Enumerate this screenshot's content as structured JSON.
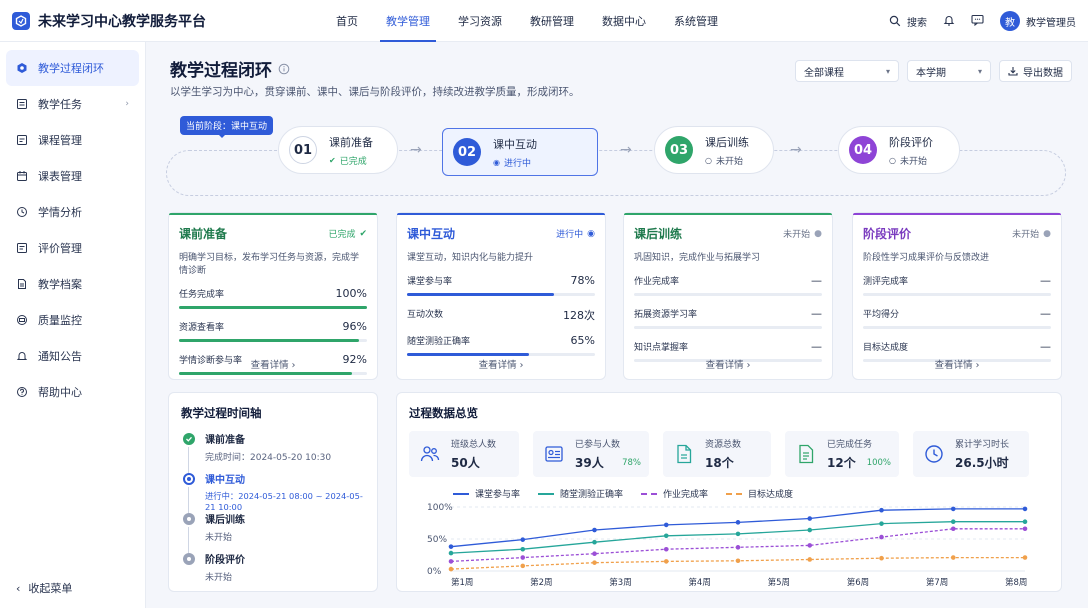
{
  "app": {
    "title": "未来学习中心教学服务平台"
  },
  "nav": [
    "首页",
    "教学管理",
    "学习资源",
    "教研管理",
    "数据中心",
    "系统管理"
  ],
  "nav_active": 1,
  "top": {
    "search": "搜索",
    "avatar_text": "教",
    "user": "教学管理员"
  },
  "sidebar": {
    "items": [
      {
        "label": "教学过程闭环",
        "icon": "loop-icon",
        "active": true
      },
      {
        "label": "教学任务",
        "icon": "task-icon",
        "has_children": true
      },
      {
        "label": "课程管理",
        "icon": "course-icon"
      },
      {
        "label": "课表管理",
        "icon": "calendar-icon"
      },
      {
        "label": "学情分析",
        "icon": "clock-icon"
      },
      {
        "label": "评价管理",
        "icon": "review-icon"
      },
      {
        "label": "教学档案",
        "icon": "archive-icon"
      },
      {
        "label": "质量监控",
        "icon": "monitor-icon"
      },
      {
        "label": "通知公告",
        "icon": "bell-icon"
      },
      {
        "label": "帮助中心",
        "icon": "help-icon"
      }
    ],
    "collapse": "收起菜单"
  },
  "page": {
    "title": "教学过程闭环",
    "subtitle": "以学生学习为中心，贯穿课前、课中、课后与阶段评价，持续改进教学质量，形成闭环。",
    "select_course": "全部课程",
    "select_term": "本学期",
    "export": "导出数据"
  },
  "flow": {
    "current_tag": "当前阶段：课中互动",
    "stages": [
      {
        "num": "01",
        "name": "课前准备",
        "status": "已完成",
        "state": "done"
      },
      {
        "num": "02",
        "name": "课中互动",
        "status": "进行中",
        "state": "active"
      },
      {
        "num": "03",
        "name": "课后训练",
        "status": "未开始",
        "state": "todo"
      },
      {
        "num": "04",
        "name": "阶段评价",
        "status": "未开始",
        "state": "todo"
      }
    ]
  },
  "cards": [
    {
      "title": "课前准备",
      "badge": "已完成",
      "desc": "明确学习目标，发布学习任务与资源，完成学情诊断",
      "color": "#2fa56a",
      "metrics": [
        {
          "label": "任务完成率",
          "value": "100%",
          "pct": 1.0
        },
        {
          "label": "资源查看率",
          "value": "96%",
          "pct": 0.96
        },
        {
          "label": "学情诊断参与率",
          "value": "92%",
          "pct": 0.92
        }
      ],
      "link": "查看详情 ›"
    },
    {
      "title": "课中互动",
      "badge": "进行中",
      "desc": "课堂互动，知识内化与能力提升",
      "color": "#2f5bd8",
      "metrics": [
        {
          "label": "课堂参与率",
          "value": "78%",
          "pct": 0.78
        },
        {
          "label": "互动次数",
          "value": "128次",
          "pct": 0
        },
        {
          "label": "随堂测验正确率",
          "value": "65%",
          "pct": 0.65
        }
      ],
      "link": "查看详情 ›"
    },
    {
      "title": "课后训练",
      "badge": "未开始",
      "desc": "巩固知识，完成作业与拓展学习",
      "color": "#2fa56a",
      "metrics": [
        {
          "label": "作业完成率",
          "value": "—",
          "pct": 0
        },
        {
          "label": "拓展资源学习率",
          "value": "—",
          "pct": 0
        },
        {
          "label": "知识点掌握率",
          "value": "—",
          "pct": 0
        }
      ],
      "link": "查看详情 ›"
    },
    {
      "title": "阶段评价",
      "badge": "未开始",
      "desc": "阶段性学习成果评价与反馈改进",
      "color": "#8e44d6",
      "metrics": [
        {
          "label": "测评完成率",
          "value": "—",
          "pct": 0
        },
        {
          "label": "平均得分",
          "value": "—",
          "pct": 0
        },
        {
          "label": "目标达成度",
          "value": "—",
          "pct": 0
        }
      ],
      "link": "查看详情 ›"
    }
  ],
  "timeline": {
    "title": "教学过程时间轴",
    "items": [
      {
        "name": "课前准备",
        "sub": "完成时间：2024-05-20 10:30",
        "state": "done"
      },
      {
        "name": "课中互动",
        "sub": "进行中：2024-05-21 08:00 ~ 2024-05-21 10:00",
        "state": "active"
      },
      {
        "name": "课后训练",
        "sub": "未开始",
        "state": "todo"
      },
      {
        "name": "阶段评价",
        "sub": "未开始",
        "state": "todo"
      }
    ]
  },
  "overview": {
    "title": "过程数据总览",
    "stats": [
      {
        "label": "班级总人数",
        "value": "50人",
        "icon": "users-icon"
      },
      {
        "label": "已参与人数",
        "value": "39人",
        "pct": "78%",
        "icon": "id-card-icon"
      },
      {
        "label": "资源总数",
        "value": "18个",
        "icon": "file-icon"
      },
      {
        "label": "已完成任务",
        "value": "12个",
        "pct": "100%",
        "icon": "doc-icon"
      },
      {
        "label": "累计学习时长",
        "value": "26.5小时",
        "icon": "clock-icon"
      }
    ]
  },
  "colors": {
    "primary": "#2f5bd8",
    "green": "#2fa56a",
    "teal": "#26a69a",
    "purple": "#9b4fd6",
    "orange": "#f0a04b"
  },
  "chart_data": {
    "type": "line",
    "x": [
      "第1周",
      "第2周",
      "第3周",
      "第4周",
      "第5周",
      "第6周",
      "第7周",
      "第8周"
    ],
    "y_ticks": [
      "100%",
      "50%",
      "0%"
    ],
    "ylim": [
      0,
      100
    ],
    "series": [
      {
        "name": "课堂参与率",
        "color": "#2f5bd8",
        "dash": false,
        "values": [
          38,
          49,
          64,
          72,
          76,
          82,
          95,
          97,
          97
        ]
      },
      {
        "name": "随堂测验正确率",
        "color": "#26a69a",
        "dash": false,
        "values": [
          28,
          34,
          45,
          55,
          58,
          64,
          74,
          77,
          77
        ]
      },
      {
        "name": "作业完成率",
        "color": "#9b4fd6",
        "dash": true,
        "values": [
          15,
          21,
          27,
          34,
          37,
          40,
          53,
          66,
          66
        ]
      },
      {
        "name": "目标达成度",
        "color": "#f0a04b",
        "dash": true,
        "values": [
          3,
          8,
          13,
          15,
          16,
          18,
          20,
          21,
          21
        ]
      }
    ]
  }
}
